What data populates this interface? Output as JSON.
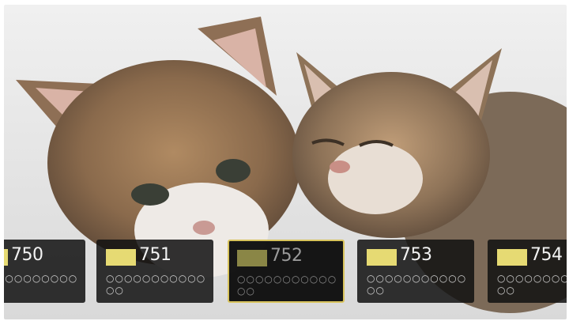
{
  "colors": {
    "wall": "#e6e6e6",
    "card_bg": "#1a1a1a",
    "swatch": "#e6da73",
    "selected_border": "#d8c35c"
  },
  "image": {
    "subject_icon": "two-tabby-kittens-photo"
  },
  "channels": [
    {
      "number": "750",
      "rating": "○○○○○○○○○○○○○",
      "selected": false
    },
    {
      "number": "751",
      "rating": "○○○○○○○○○○○○○",
      "selected": false
    },
    {
      "number": "752",
      "rating": "○○○○○○○○○○○○○",
      "selected": true
    },
    {
      "number": "753",
      "rating": "○○○○○○○○○○○○○",
      "selected": false
    },
    {
      "number": "754",
      "rating": "○○○○○○○○○○○○○",
      "selected": false
    }
  ]
}
